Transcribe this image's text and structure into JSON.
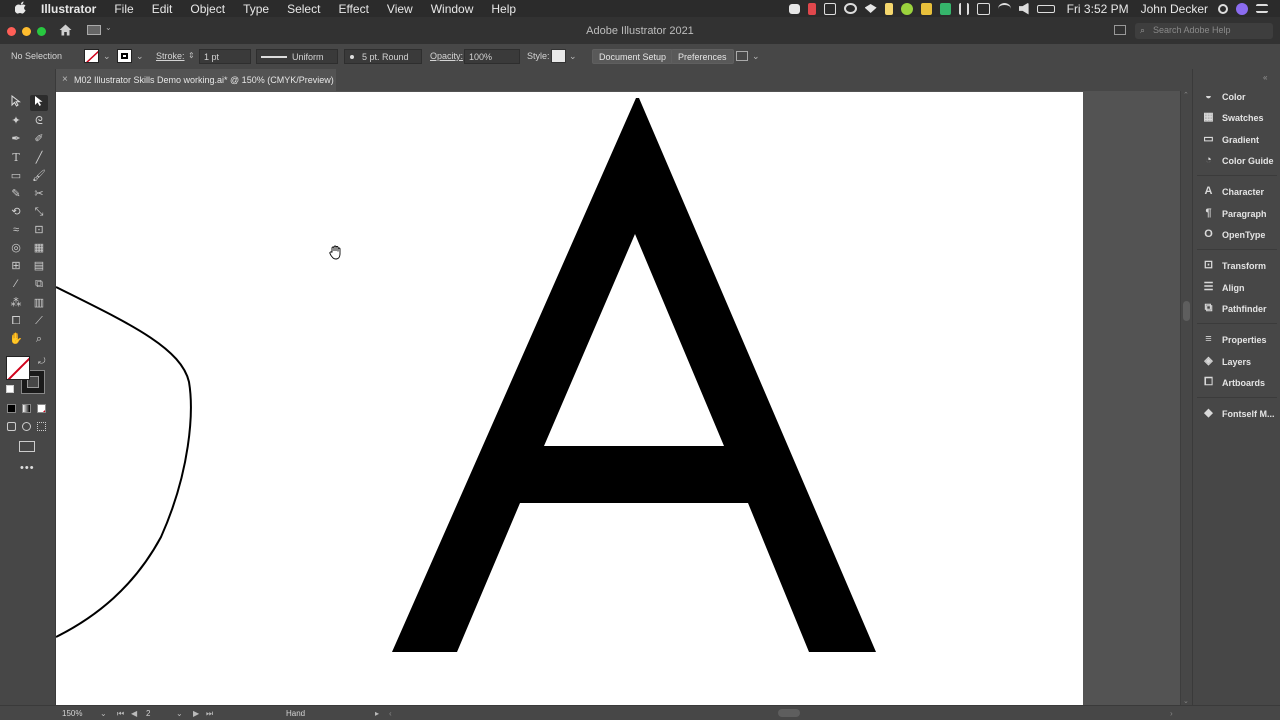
{
  "menubar": {
    "apple": "",
    "items": [
      "Illustrator",
      "File",
      "Edit",
      "Object",
      "Type",
      "Select",
      "Effect",
      "View",
      "Window",
      "Help"
    ],
    "clock": "Fri 3:52 PM",
    "user": "John Decker"
  },
  "window": {
    "title": "Adobe Illustrator 2021",
    "search_placeholder": "Search Adobe Help"
  },
  "control_bar": {
    "selection": "No Selection",
    "stroke_label": "Stroke:",
    "stroke_weight": "1 pt",
    "stroke_profile": "Uniform",
    "brush": "5 pt. Round",
    "opacity_label": "Opacity:",
    "opacity_value": "100%",
    "style_label": "Style:",
    "document_setup": "Document Setup",
    "preferences": "Preferences"
  },
  "document_tab": {
    "close": "×",
    "title": "M02 Illustrator Skills Demo working.ai* @ 150% (CMYK/Preview)"
  },
  "panels": [
    "Color",
    "Swatches",
    "Gradient",
    "Color Guide",
    "Character",
    "Paragraph",
    "OpenType",
    "Transform",
    "Align",
    "Pathfinder",
    "Properties",
    "Layers",
    "Artboards",
    "Fontself M..."
  ],
  "status_bar": {
    "zoom": "150%",
    "artboard_number": "2",
    "current_tool": "Hand"
  },
  "colors": {
    "fill_none_slash": "#d0021b",
    "letter": "#000000",
    "artboard": "#ffffff"
  }
}
